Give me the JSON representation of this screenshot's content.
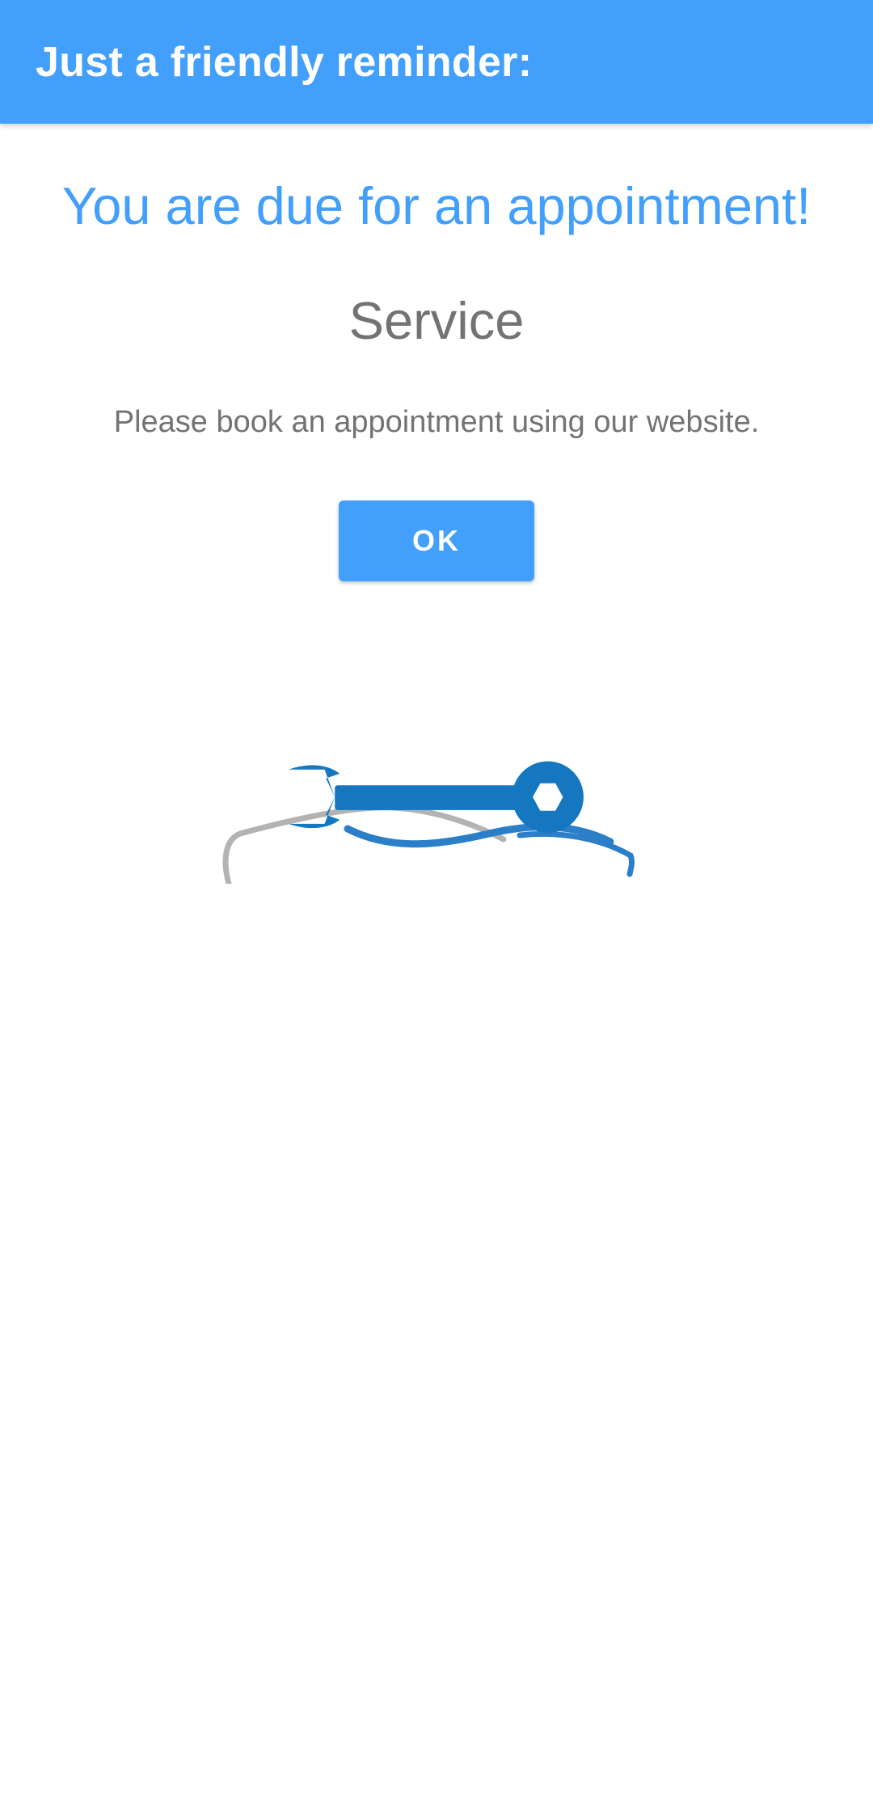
{
  "app_bar": {
    "title": "Just a friendly reminder:",
    "background_color": "#429ffc"
  },
  "reminder": {
    "headline": "You are due for an appointment!",
    "service_name": "Service",
    "instruction": "Please book an appointment using our website.",
    "ok_label": "OK"
  },
  "logo": {
    "icon": "car-wrench-logo-icon",
    "colors": {
      "car_outline": "#b3b3b3",
      "car_accent": "#2b7fc8",
      "wrench": "#1577bf"
    }
  }
}
